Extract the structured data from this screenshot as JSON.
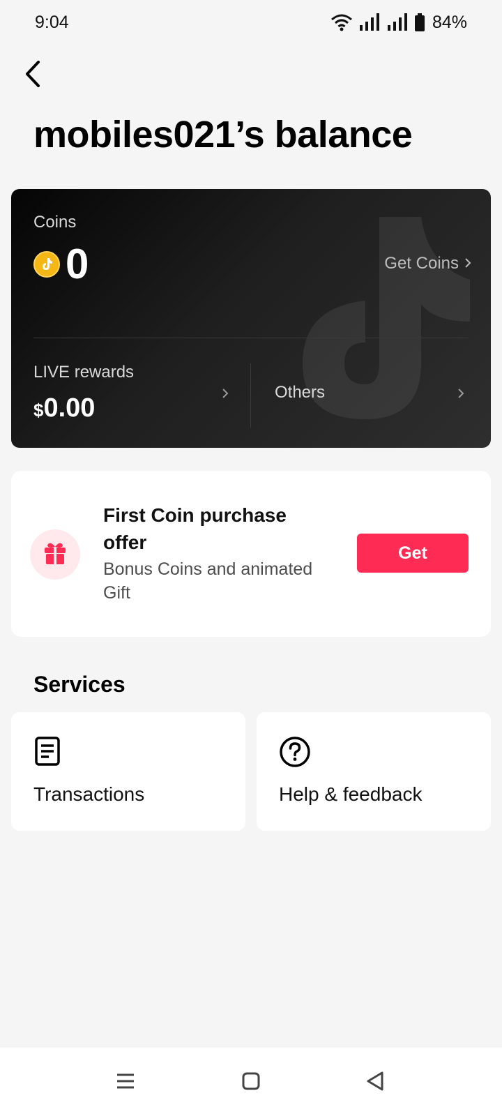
{
  "status_bar": {
    "time": "9:04",
    "battery": "84%"
  },
  "header": {
    "back_icon": "back-arrow-icon",
    "title": "mobiles021’s balance"
  },
  "balance_card": {
    "coins_label": "Coins",
    "coins_value": "0",
    "get_coins_label": "Get Coins",
    "live_rewards_label": "LIVE rewards",
    "live_rewards_currency": "$",
    "live_rewards_amount": "0.00",
    "others_label": "Others"
  },
  "offer": {
    "title": "First Coin purchase offer",
    "subtitle": "Bonus Coins and animated Gift",
    "button_label": "Get"
  },
  "services": {
    "title": "Services",
    "items": [
      {
        "label": "Transactions",
        "icon": "document-icon"
      },
      {
        "label": "Help & feedback",
        "icon": "help-icon"
      }
    ]
  },
  "colors": {
    "accent": "#fe2c55",
    "coin": "#f5b716",
    "card_dark": "#1a1a1a"
  }
}
